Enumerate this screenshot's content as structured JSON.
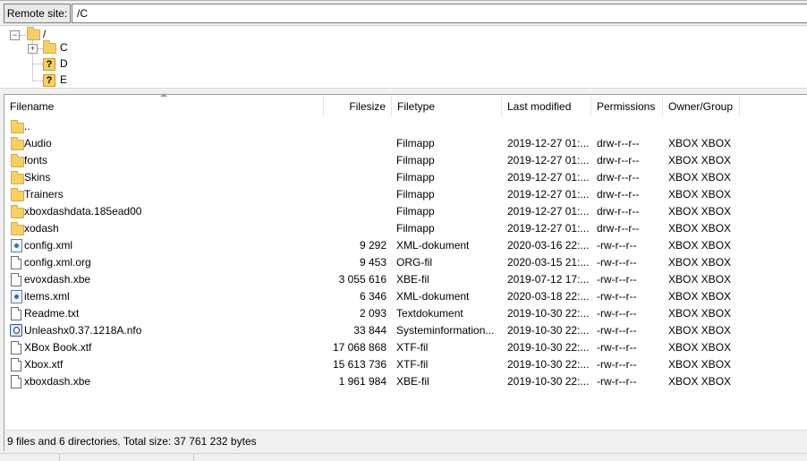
{
  "remote": {
    "label": "Remote site:",
    "path": "/C"
  },
  "tree": {
    "root": "/",
    "children": [
      "C",
      "D",
      "E"
    ]
  },
  "columns": {
    "filename": "Filename",
    "filesize": "Filesize",
    "filetype": "Filetype",
    "last_modified": "Last modified",
    "permissions": "Permissions",
    "owner": "Owner/Group"
  },
  "files": [
    {
      "name": "..",
      "size": "",
      "type": "",
      "modified": "",
      "perms": "",
      "owner": "",
      "icon": "folder-icon"
    },
    {
      "name": "Audio",
      "size": "",
      "type": "Filmapp",
      "modified": "2019-12-27 01:...",
      "perms": "drw-r--r--",
      "owner": "XBOX XBOX",
      "icon": "folder-icon"
    },
    {
      "name": "fonts",
      "size": "",
      "type": "Filmapp",
      "modified": "2019-12-27 01:...",
      "perms": "drw-r--r--",
      "owner": "XBOX XBOX",
      "icon": "folder-icon"
    },
    {
      "name": "Skins",
      "size": "",
      "type": "Filmapp",
      "modified": "2019-12-27 01:...",
      "perms": "drw-r--r--",
      "owner": "XBOX XBOX",
      "icon": "folder-icon"
    },
    {
      "name": "Trainers",
      "size": "",
      "type": "Filmapp",
      "modified": "2019-12-27 01:...",
      "perms": "drw-r--r--",
      "owner": "XBOX XBOX",
      "icon": "folder-icon"
    },
    {
      "name": "xboxdashdata.185ead00",
      "size": "",
      "type": "Filmapp",
      "modified": "2019-12-27 01:...",
      "perms": "drw-r--r--",
      "owner": "XBOX XBOX",
      "icon": "folder-icon"
    },
    {
      "name": "xodash",
      "size": "",
      "type": "Filmapp",
      "modified": "2019-12-27 01:...",
      "perms": "drw-r--r--",
      "owner": "XBOX XBOX",
      "icon": "folder-icon"
    },
    {
      "name": "config.xml",
      "size": "9 292",
      "type": "XML-dokument",
      "modified": "2020-03-16 22:...",
      "perms": "-rw-r--r--",
      "owner": "XBOX XBOX",
      "icon": "xml-file-icon"
    },
    {
      "name": "config.xml.org",
      "size": "9 453",
      "type": "ORG-fil",
      "modified": "2020-03-15 21:...",
      "perms": "-rw-r--r--",
      "owner": "XBOX XBOX",
      "icon": "file-icon"
    },
    {
      "name": "evoxdash.xbe",
      "size": "3 055 616",
      "type": "XBE-fil",
      "modified": "2019-07-12 17:...",
      "perms": "-rw-r--r--",
      "owner": "XBOX XBOX",
      "icon": "file-icon"
    },
    {
      "name": "items.xml",
      "size": "6 346",
      "type": "XML-dokument",
      "modified": "2020-03-18 22:...",
      "perms": "-rw-r--r--",
      "owner": "XBOX XBOX",
      "icon": "xml-file-icon"
    },
    {
      "name": "Readme.txt",
      "size": "2 093",
      "type": "Textdokument",
      "modified": "2019-10-30 22:...",
      "perms": "-rw-r--r--",
      "owner": "XBOX XBOX",
      "icon": "text-file-icon"
    },
    {
      "name": "Unleashx0.37.1218A.nfo",
      "size": "33 844",
      "type": "Systeminformation...",
      "modified": "2019-10-30 22:...",
      "perms": "-rw-r--r--",
      "owner": "XBOX XBOX",
      "icon": "nfo-file-icon"
    },
    {
      "name": "XBox Book.xtf",
      "size": "17 068 868",
      "type": "XTF-fil",
      "modified": "2019-10-30 22:...",
      "perms": "-rw-r--r--",
      "owner": "XBOX XBOX",
      "icon": "file-icon"
    },
    {
      "name": "Xbox.xtf",
      "size": "15 613 736",
      "type": "XTF-fil",
      "modified": "2019-10-30 22:...",
      "perms": "-rw-r--r--",
      "owner": "XBOX XBOX",
      "icon": "file-icon"
    },
    {
      "name": "xboxdash.xbe",
      "size": "1 961 984",
      "type": "XBE-fil",
      "modified": "2019-10-30 22:...",
      "perms": "-rw-r--r--",
      "owner": "XBOX XBOX",
      "icon": "file-icon"
    }
  ],
  "status": {
    "text": "9 files and 6 directories. Total size: 37 761 232 bytes"
  }
}
